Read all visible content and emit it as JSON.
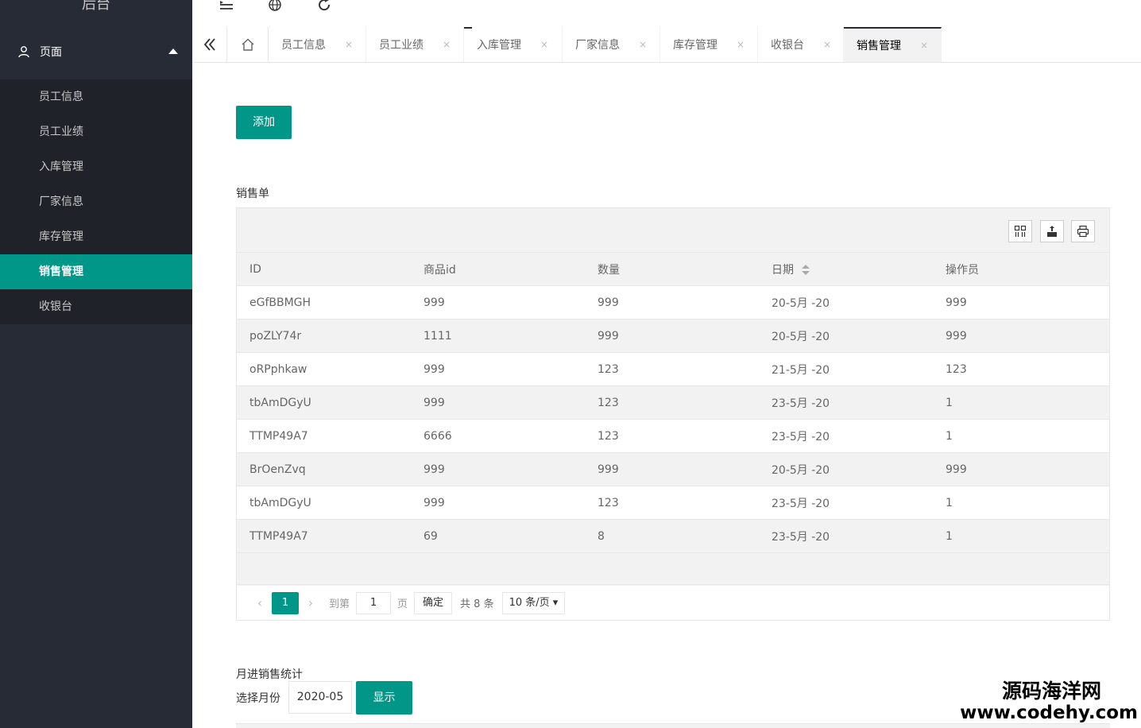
{
  "sidebar": {
    "logo": "后台",
    "group_label": "页面",
    "items": [
      {
        "label": "员工信息"
      },
      {
        "label": "员工业绩"
      },
      {
        "label": "入库管理"
      },
      {
        "label": "厂家信息"
      },
      {
        "label": "库存管理"
      },
      {
        "label": "销售管理",
        "active": true
      },
      {
        "label": "收银台"
      }
    ]
  },
  "tabs": [
    {
      "label": "员工信息"
    },
    {
      "label": "员工业绩"
    },
    {
      "label": "入库管理"
    },
    {
      "label": "厂家信息"
    },
    {
      "label": "库存管理"
    },
    {
      "label": "收银台"
    },
    {
      "label": "销售管理",
      "active": true
    }
  ],
  "tab_close": "×",
  "content": {
    "add_button": "添加",
    "section_title": "销售单",
    "table": {
      "headers": [
        "ID",
        "商品id",
        "数量",
        "日期",
        "操作员"
      ],
      "rows": [
        [
          "eGfBBMGH",
          "999",
          "999",
          "20-5月 -20",
          "999"
        ],
        [
          "poZLY74r",
          "1111",
          "999",
          "20-5月 -20",
          "999"
        ],
        [
          "oRPphkaw",
          "999",
          "123",
          "21-5月 -20",
          "123"
        ],
        [
          "tbAmDGyU",
          "999",
          "123",
          "23-5月 -20",
          "1"
        ],
        [
          "TTMP49A7",
          "6666",
          "123",
          "23-5月 -20",
          "1"
        ],
        [
          "BrOenZvq",
          "999",
          "999",
          "20-5月 -20",
          "999"
        ],
        [
          "tbAmDGyU",
          "999",
          "123",
          "23-5月 -20",
          "1"
        ],
        [
          "TTMP49A7",
          "69",
          "8",
          "23-5月 -20",
          "1"
        ]
      ]
    },
    "pager": {
      "prev": "‹",
      "current": "1",
      "next": "›",
      "goto_label": "到第",
      "goto_value": "1",
      "page_label": "页",
      "ok": "确定",
      "total": "共 8 条",
      "size": "10 条/页 ▾"
    },
    "month": {
      "title": "月进销售统计",
      "label": "选择月份",
      "value": "2020-05",
      "show_button": "显示"
    }
  },
  "watermark": {
    "line1": "源码海洋网",
    "line2": "www.codehy.com"
  },
  "colors": {
    "accent": "#009688",
    "sidebar_bg": "#272b35",
    "submenu_bg": "#1f2229"
  }
}
